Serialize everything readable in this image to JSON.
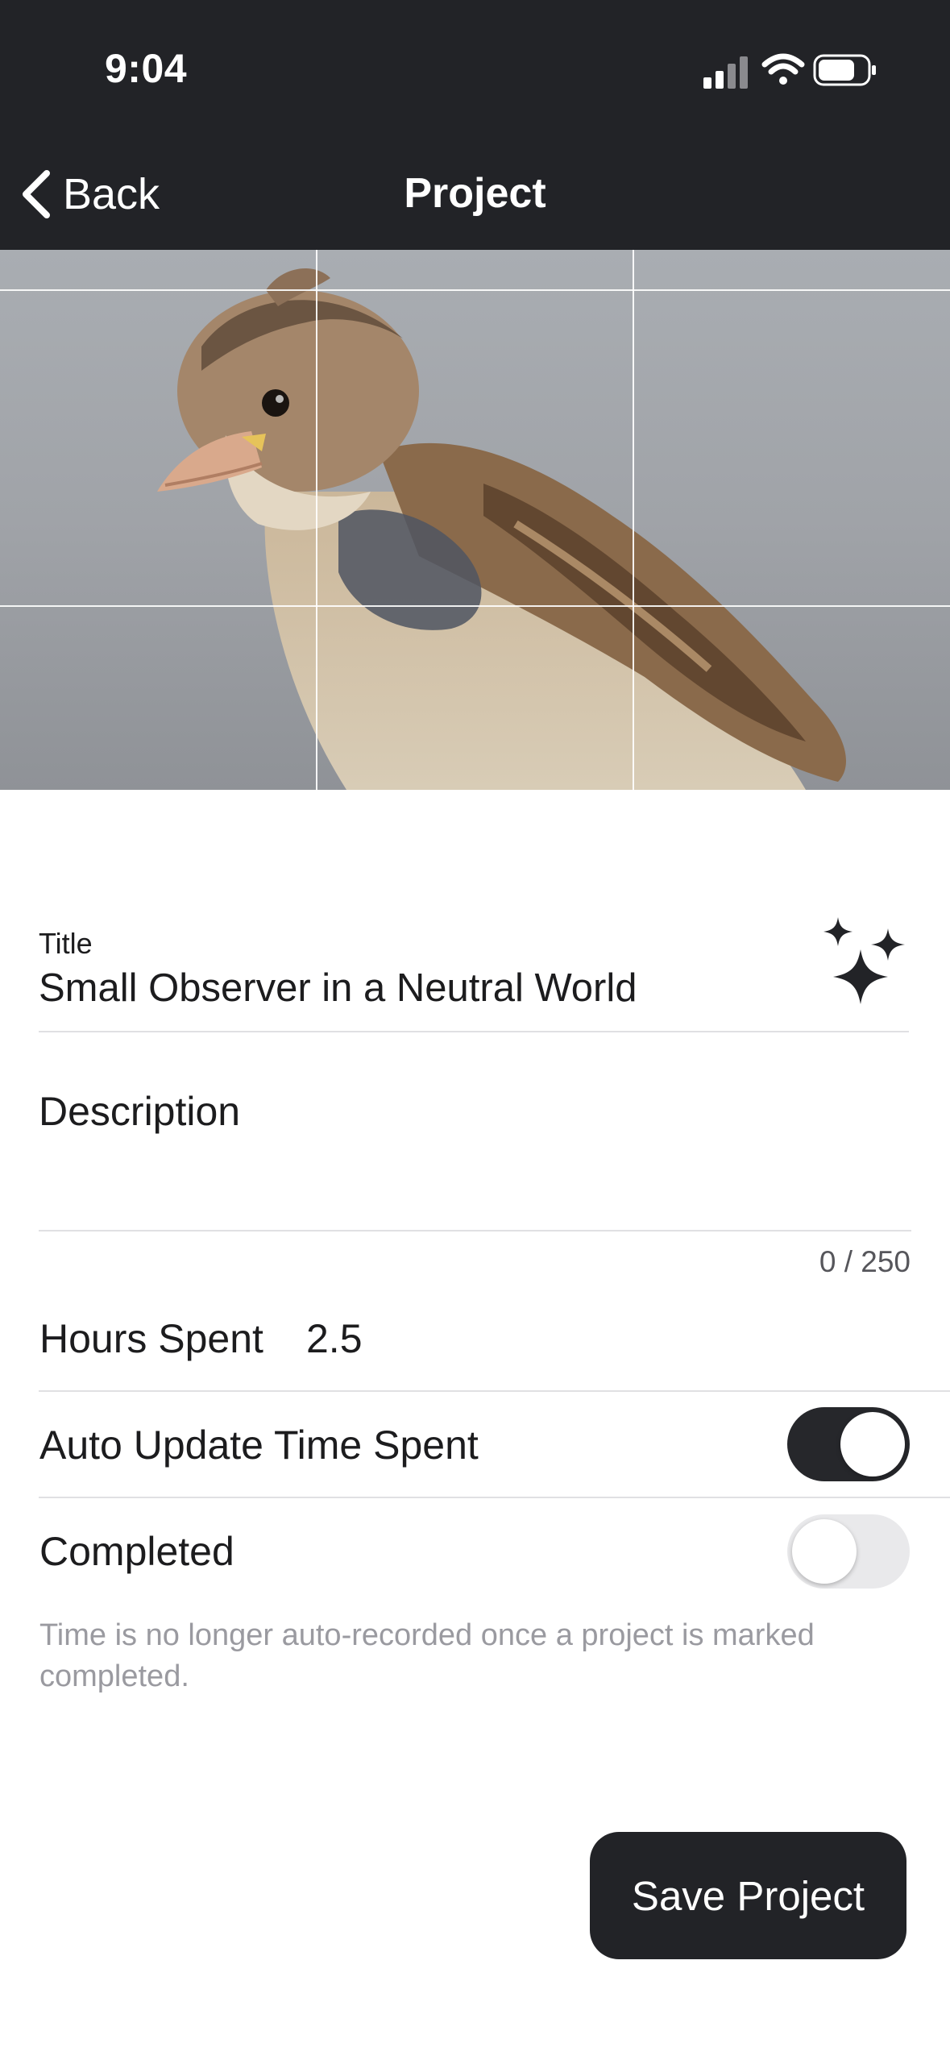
{
  "status_bar": {
    "time": "9:04"
  },
  "nav": {
    "back_label": "Back",
    "title": "Project"
  },
  "form": {
    "title_label": "Title",
    "title_value": "Small Observer in a Neutral World",
    "description_placeholder": "Description",
    "description_value": "",
    "char_counter": "0 / 250",
    "hours_label": "Hours Spent",
    "hours_value": "2.5",
    "auto_update_label": "Auto Update Time Spent",
    "auto_update_on": true,
    "completed_label": "Completed",
    "completed_on": false,
    "help_text": "Time is no longer auto-recorded once a project is marked completed."
  },
  "actions": {
    "save_label": "Save Project"
  },
  "icons": {
    "back": "chevron-left-icon",
    "ai": "sparkles-icon",
    "signal": "cellular-signal-icon",
    "wifi": "wifi-icon",
    "battery": "battery-icon"
  },
  "colors": {
    "header_bg": "#222327",
    "toggle_on": "#26272b",
    "toggle_off": "#e9e9eb",
    "button_bg": "#222327"
  }
}
